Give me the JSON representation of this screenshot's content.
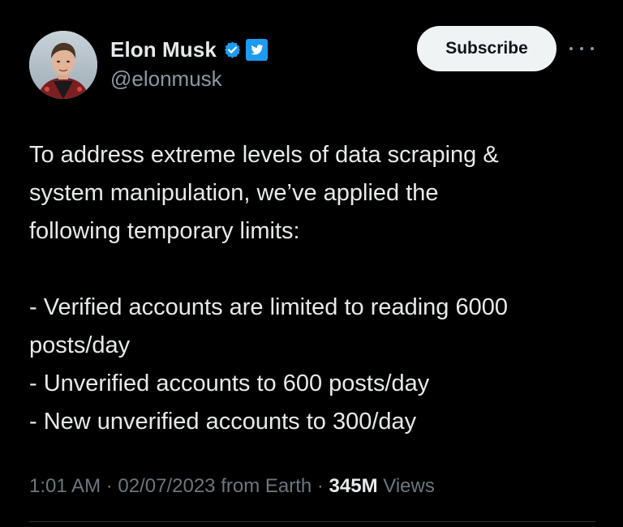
{
  "author": {
    "display_name": "Elon Musk",
    "handle": "@elonmusk",
    "avatar_icon": "profile-photo",
    "verified_badge_color": "#1d9bf0",
    "affiliation_badge_icon": "twitter-bird-icon"
  },
  "actions": {
    "subscribe_label": "Subscribe",
    "more_icon": "more-dots-icon"
  },
  "tweet": {
    "lines": [
      "To address extreme levels of data scraping &",
      "system manipulation, we’ve applied the",
      "following temporary limits:",
      "- Verified accounts are limited to reading 6000",
      "posts/day",
      "- Unverified accounts to 600 posts/day",
      "- New unverified accounts to 300/day"
    ]
  },
  "meta": {
    "time": "1:01 AM",
    "separator": " · ",
    "date": "02/07/2023",
    "source": "from Earth",
    "views_count": "345M",
    "views_label": "Views"
  },
  "colors": {
    "background": "#000000",
    "text": "#e7e9ea",
    "secondary_text": "#8b98a5",
    "button_bg": "#eff3f4"
  }
}
